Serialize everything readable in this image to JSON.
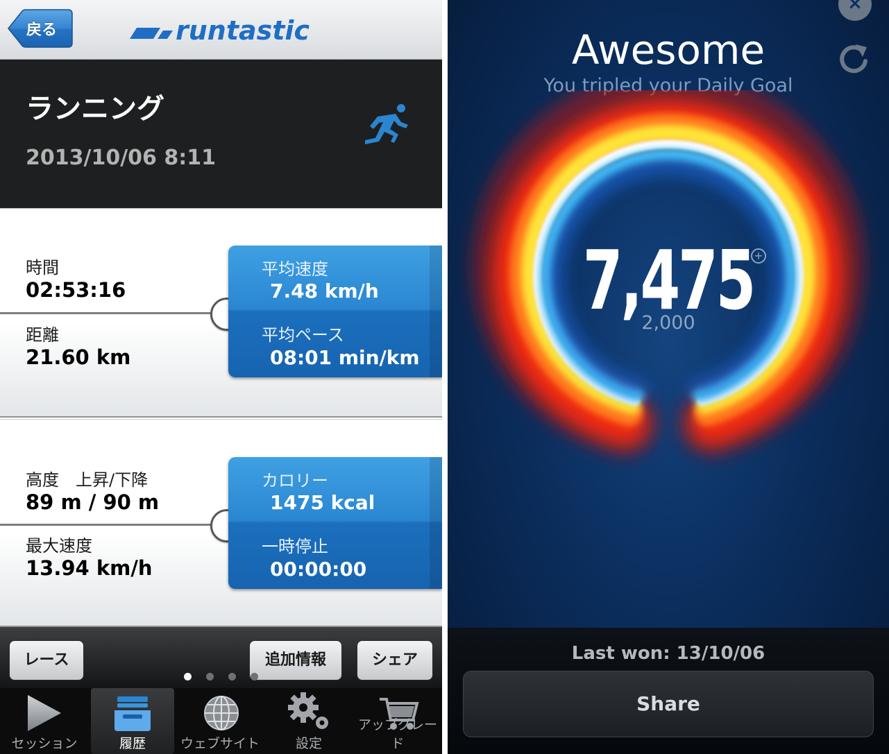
{
  "left": {
    "nav": {
      "back_label": "戻る",
      "logo_text": "runtastic"
    },
    "header": {
      "title": "ランニング",
      "datetime": "2013/10/06 8:11"
    },
    "card1": {
      "left_stats": [
        {
          "label": "時間",
          "value": "02:53:16"
        },
        {
          "label": "距離",
          "value": "21.60 km"
        }
      ],
      "right_stats": [
        {
          "label": "平均速度",
          "value": "7.48 km/h"
        },
        {
          "label": "平均ペース",
          "value": "08:01 min/km"
        }
      ]
    },
    "card2": {
      "left_stats": [
        {
          "label": "高度　上昇/下降",
          "value": "89 m / 90 m"
        },
        {
          "label": "最大速度",
          "value": "13.94 km/h"
        }
      ],
      "right_stats": [
        {
          "label": "カロリー",
          "value": "1475 kcal"
        },
        {
          "label": "一時停止",
          "value": "00:00:00"
        }
      ]
    },
    "actions": {
      "race": "レース",
      "more_info": "追加情報",
      "share": "シェア"
    },
    "pager": {
      "pages": 4,
      "current": 1
    },
    "tabs": [
      {
        "label": "セッション",
        "icon": "play-icon"
      },
      {
        "label": "履歴",
        "icon": "inbox-tray-icon",
        "active": true
      },
      {
        "label": "ウェブサイト",
        "icon": "globe-icon"
      },
      {
        "label": "設定",
        "icon": "gear-icon"
      },
      {
        "label": "アップグレード",
        "icon": "cart-icon"
      }
    ]
  },
  "right": {
    "close_icon": "close-icon",
    "refresh_icon": "refresh-icon",
    "title": "Awesome",
    "subtitle": "You tripled your Daily Goal",
    "steps": "7,475",
    "goal": "2,000",
    "last_won": "Last won: 13/10/06",
    "share_label": "Share"
  },
  "colors": {
    "brand_blue": "#1f6ec4",
    "stat_box_blue": "#2a86d1",
    "header_dark": "#1e1f20",
    "award_bg": "#0b2e5e"
  }
}
